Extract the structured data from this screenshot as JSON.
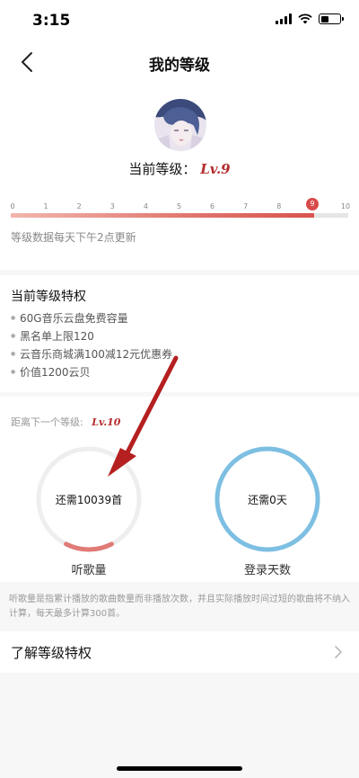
{
  "status_bar": {
    "time": "3:15"
  },
  "nav": {
    "title": "我的等级"
  },
  "current_level": {
    "label": "当前等级：",
    "badge": "Lv.9"
  },
  "progress": {
    "ticks": [
      "0",
      "1",
      "2",
      "3",
      "4",
      "5",
      "6",
      "7",
      "8",
      "9",
      "10"
    ],
    "current_tick": "9",
    "fraction": 0.9,
    "update_note": "等级数据每天下午2点更新"
  },
  "privileges": {
    "title": "当前等级特权",
    "items": [
      "60G音乐云盘免费容量",
      "黑名单上限120",
      "云音乐商城满100减12元优惠券",
      "价值1200云贝"
    ]
  },
  "next_level": {
    "label": "距离下一个等级:",
    "badge": "Lv.10",
    "listen": {
      "text": "还需10039首",
      "label": "听歌量",
      "progress": 0.15,
      "color": "#e07b76"
    },
    "login": {
      "text": "还需0天",
      "label": "登录天数",
      "progress": 1.0,
      "color": "#7dbfe2"
    }
  },
  "note": "听歌量是指累计播放的歌曲数量而非播放次数，并且实际播放时间过短的歌曲将不纳入计算，每天最多计算300首。",
  "learn_more": {
    "label": "了解等级特权"
  },
  "colors": {
    "accent": "#d9534f",
    "arrow": "#b51f1f",
    "login_ring": "#7dbfe2",
    "listen_ring": "#e07b76"
  }
}
